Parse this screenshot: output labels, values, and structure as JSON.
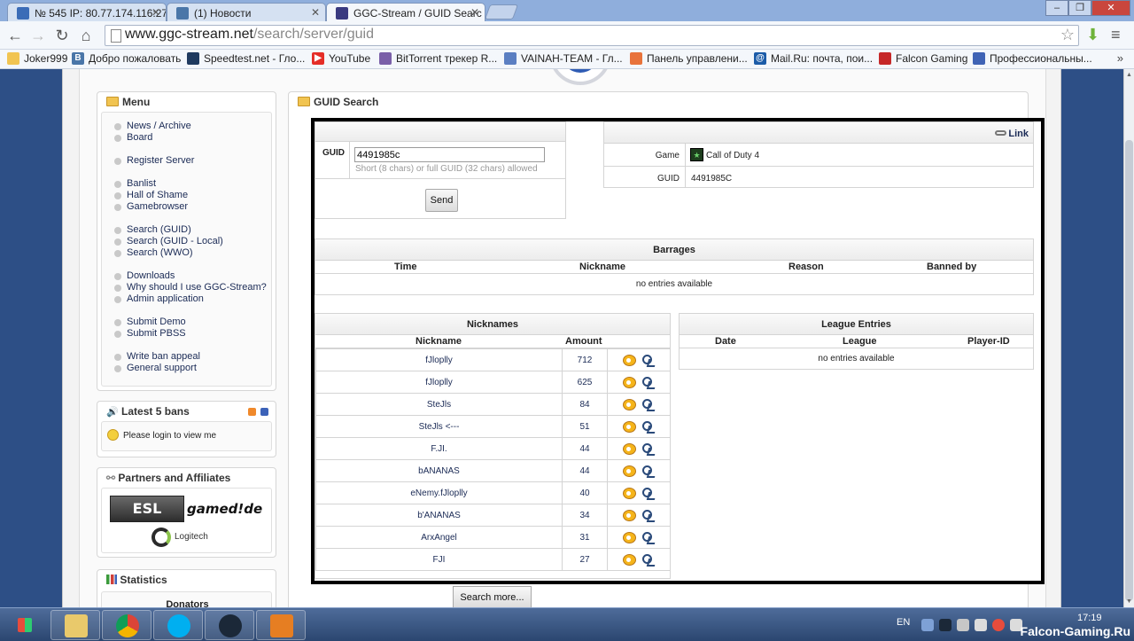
{
  "browser": {
    "tabs": [
      {
        "title": "№ 545 IP: 80.77.174.116:27",
        "color": "#3b6cb7"
      },
      {
        "title": "(1) Новости",
        "color": "#4a76a8"
      },
      {
        "title": "GGC-Stream / GUID Searc",
        "color": "#3a3a80"
      }
    ],
    "url_host": "www.ggc-stream.net",
    "url_path": "/search/server/guid",
    "bookmarks": [
      {
        "label": "Joker999",
        "icon": "folder-icon",
        "color": "#f1c451"
      },
      {
        "label": "Добро пожаловать",
        "icon": "vk-icon",
        "color": "#4a76a8"
      },
      {
        "label": "Speedtest.net - Гло...",
        "icon": "speedtest-icon",
        "color": "#1f3a5f"
      },
      {
        "label": "YouTube",
        "icon": "youtube-icon",
        "color": "#e52d27"
      },
      {
        "label": "BitTorrent трекер R...",
        "icon": "torrent-icon",
        "color": "#7a5fa8"
      },
      {
        "label": "VAINAH-TEAM - Гл...",
        "icon": "vainah-icon",
        "color": "#5b7fc2"
      },
      {
        "label": "Панель управлени...",
        "icon": "panel-icon",
        "color": "#e8733b"
      },
      {
        "label": "Mail.Ru: почта, пои...",
        "icon": "mailru-icon",
        "color": "#1c5ca8"
      },
      {
        "label": "Falcon Gaming",
        "icon": "falcon-icon",
        "color": "#c62828"
      },
      {
        "label": "Профессиональны...",
        "icon": "pro-icon",
        "color": "#3f63b5"
      }
    ],
    "bookmarks_more": "»"
  },
  "menu": {
    "title": "Menu",
    "items": [
      "News / Archive",
      "Board",
      "Register Server",
      "Banlist",
      "Hall of Shame",
      "Gamebrowser",
      "Search (GUID)",
      "Search (GUID - Local)",
      "Search (WWO)",
      "Downloads",
      "Why should I use GGC-Stream?",
      "Admin application",
      "Submit Demo",
      "Submit PBSS",
      "Write ban appeal",
      "General support"
    ]
  },
  "latest_bans": {
    "title": "Latest 5 bans",
    "text": "Please login to view me"
  },
  "partners": {
    "title": "Partners and Affiliates",
    "esl": "ESL",
    "gamed": "gamed!de",
    "logitech": "Logitech"
  },
  "statistics": {
    "title": "Statistics",
    "donators": "Donators"
  },
  "guid_search": {
    "title": "GUID Search",
    "guid_label": "GUID",
    "guid_value": "4491985c",
    "hint": "Short (8 chars) or full GUID (32 chars) allowed",
    "send_label": "Send",
    "link_label": "Link",
    "game_label": "Game",
    "game_value": "Call of Duty 4",
    "guid_result_label": "GUID",
    "guid_result_value": "4491985C"
  },
  "barrages": {
    "title": "Barrages",
    "columns": [
      "Time",
      "Nickname",
      "Reason",
      "Banned by"
    ],
    "empty": "no entries available"
  },
  "nicknames": {
    "title": "Nicknames",
    "columns": [
      "Nickname",
      "Amount"
    ],
    "rows": [
      {
        "name": "fJloplly",
        "amount": "712"
      },
      {
        "name": "fJloplly",
        "amount": "625"
      },
      {
        "name": "SteJls",
        "amount": "84"
      },
      {
        "name": "SteJls <---",
        "amount": "51"
      },
      {
        "name": "F.JI.",
        "amount": "44"
      },
      {
        "name": "bANANAS",
        "amount": "44"
      },
      {
        "name": "eNemy.fJloplly",
        "amount": "40"
      },
      {
        "name": "b'ANANAS",
        "amount": "34"
      },
      {
        "name": "ArxAngel",
        "amount": "31"
      },
      {
        "name": "FJI",
        "amount": "27"
      }
    ],
    "more_label": "Search more..."
  },
  "league": {
    "title": "League Entries",
    "columns": [
      "Date",
      "League",
      "Player-ID"
    ],
    "empty": "no entries available"
  },
  "taskbar": {
    "lang": "EN",
    "time": "17:19",
    "watermark": "Falcon-Gaming.Ru"
  }
}
